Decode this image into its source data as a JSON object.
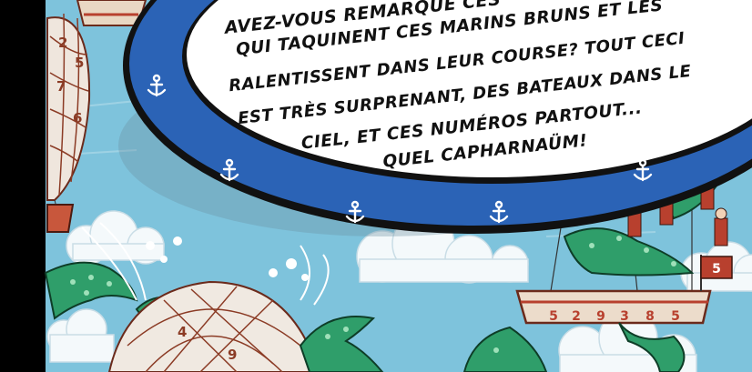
{
  "caption": {
    "lines": [
      "AVEZ-VOUS REMARQUÉ CES",
      "QUI TAQUINENT CES MARINS BRUNS ET LES",
      "RALENTISSENT DANS LEUR COURSE? TOUT CECI",
      "EST TRÈS SURPRENANT, DES BATEAUX DANS LE",
      "CIEL, ET CES NUMÉROS PARTOUT...",
      "QUEL CAPHARNAÜM!"
    ]
  },
  "boat_numbers": [
    "5",
    "2",
    "9",
    "3",
    "8",
    "5"
  ],
  "flag_number": "5",
  "balloon_numbers": [
    "2",
    "5",
    "7",
    "6",
    "4",
    "9"
  ],
  "colors": {
    "sky": "#7ec3dc",
    "cloud": "#f4f9fb",
    "frame_blue": "#2b63b6",
    "frame_dark": "#111111",
    "dragon_green": "#2f9e6a",
    "boat_red": "#b8402e"
  },
  "icons": [
    "anchor-icon"
  ]
}
